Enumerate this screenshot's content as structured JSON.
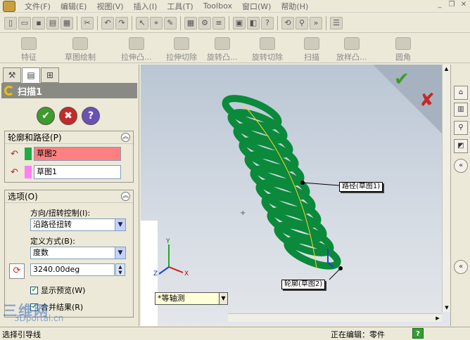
{
  "menubar": {
    "items": [
      "文件(F)",
      "编辑(E)",
      "视图(V)",
      "插入(I)",
      "工具(T)",
      "Toolbox",
      "窗口(W)",
      "帮助(H)"
    ]
  },
  "toolbar": {
    "icons": [
      "new-icon",
      "open-icon",
      "save-icon",
      "print-icon",
      "print-preview-icon",
      "cut-icon",
      "undo-icon",
      "redo-icon",
      "select-icon",
      "smart-dim-icon",
      "sketch-icon",
      "grid-icon",
      "rebuild-icon",
      "options-icon",
      "box-icon",
      "help-icon",
      "zoom-icon",
      "more-icon"
    ]
  },
  "features_toolbar": {
    "items": [
      "特征",
      "草图绘制",
      "拉伸凸...",
      "拉伸切除",
      "旋转凸...",
      "旋转切除",
      "扫描",
      "放样凸...",
      "圆角"
    ]
  },
  "panel": {
    "title": "扫描1",
    "profile_group": {
      "title": "轮廓和路径(P)",
      "profile_value": "草图2",
      "profile_color": "#22aa44",
      "path_value": "草图1",
      "path_color": "#ff80f0"
    },
    "options_group": {
      "title": "选项(O)",
      "orientation_label": "方向/扭转控制(I):",
      "orientation_value": "沿路径扭转",
      "define_label": "定义方式(B):",
      "define_value": "度数",
      "degree_value": "3240.00deg",
      "show_preview_label": "显示预览(W)",
      "merge_label": "合并结果(R)"
    }
  },
  "viewport": {
    "path_callout": "路径(草图1)",
    "profile_callout": "轮廓(草图2)",
    "view_combo": "*等轴测",
    "axis_labels": [
      "X",
      "Y",
      "Z"
    ]
  },
  "statusbar": {
    "left_text": "选择引导线",
    "right_text": "正在编辑：零件",
    "help": "?"
  },
  "watermark": {
    "line1": "三维网",
    "line2": "3Dportal.cn"
  },
  "colors": {
    "spring": "#0a8a3a",
    "accept": "#3d9b2d",
    "reject": "#c42a2a"
  }
}
